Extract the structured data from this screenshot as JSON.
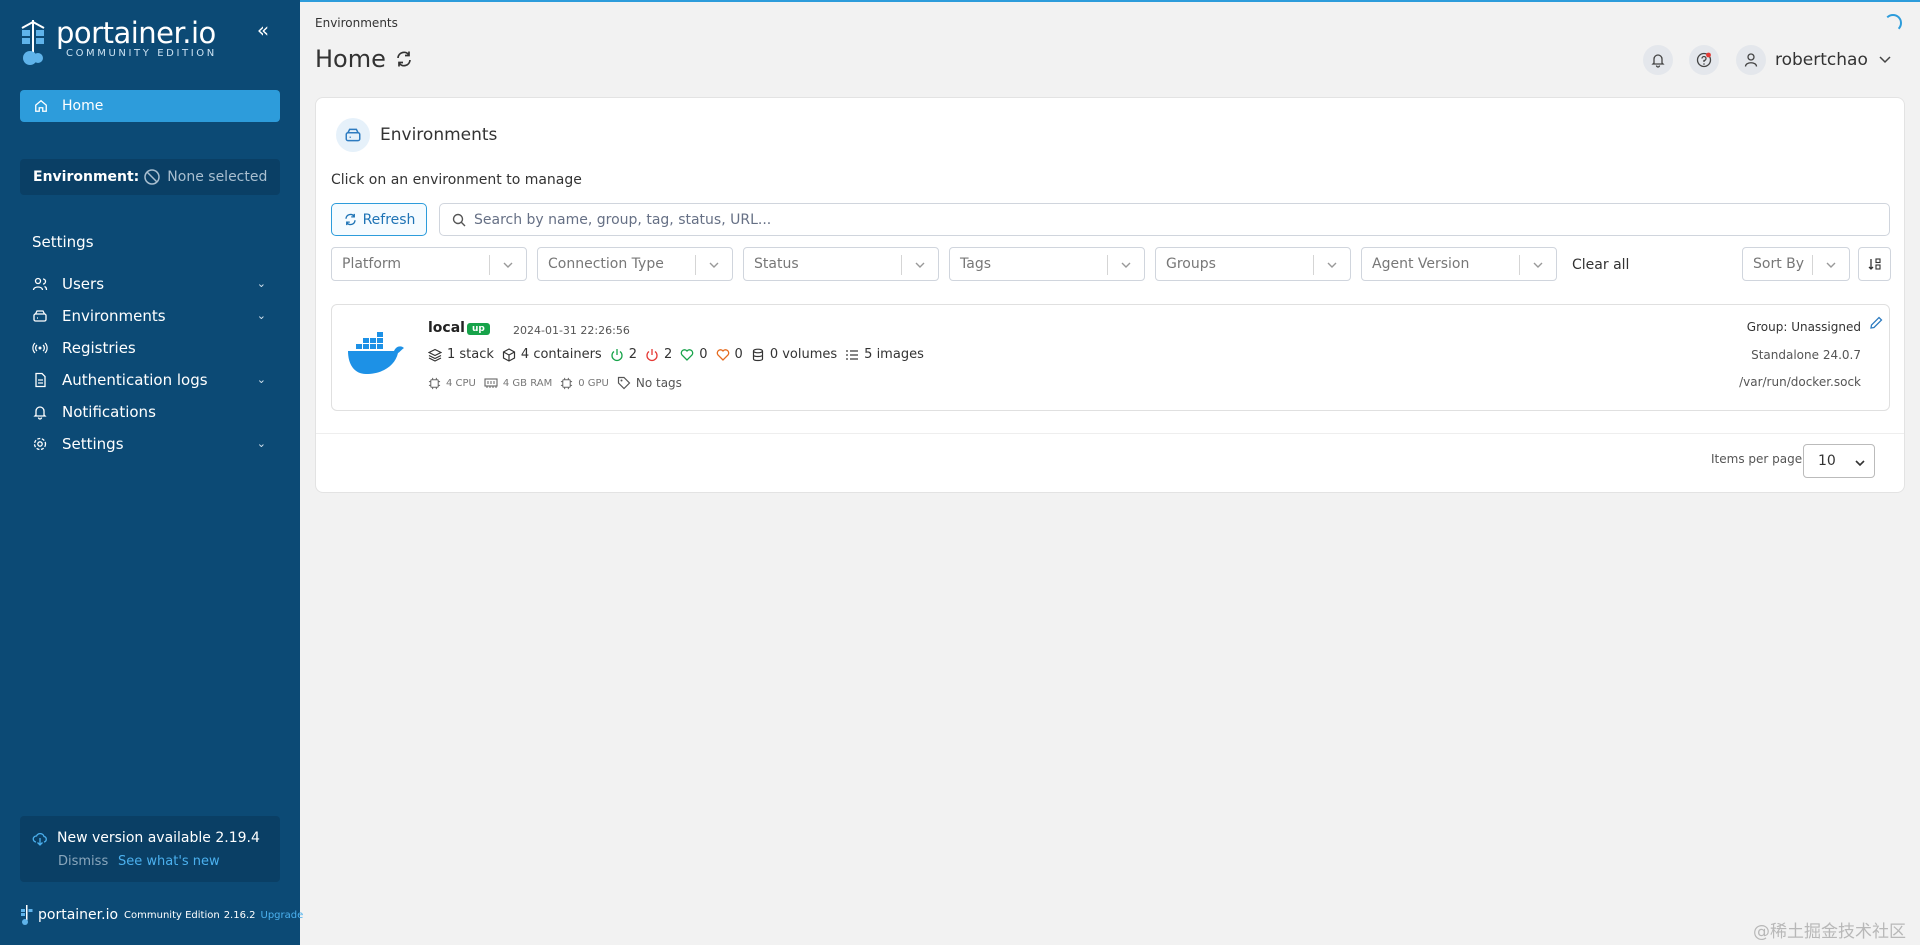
{
  "sidebar": {
    "logo_name": "portainer.io",
    "logo_sub": "COMMUNITY EDITION",
    "home_label": "Home",
    "env_label": "Environment:",
    "env_value": "None selected",
    "settings_heading": "Settings",
    "items": [
      {
        "label": "Users",
        "icon": "users-icon",
        "expandable": true
      },
      {
        "label": "Environments",
        "icon": "environments-icon",
        "expandable": true
      },
      {
        "label": "Registries",
        "icon": "registries-icon",
        "expandable": false
      },
      {
        "label": "Authentication logs",
        "icon": "auth-logs-icon",
        "expandable": true
      },
      {
        "label": "Notifications",
        "icon": "bell-icon",
        "expandable": false
      },
      {
        "label": "Settings",
        "icon": "gear-icon",
        "expandable": true
      }
    ],
    "update": {
      "title": "New version available 2.19.4",
      "dismiss": "Dismiss",
      "link": "See what's new"
    },
    "footer": {
      "name": "portainer.io",
      "edition": "Community Edition",
      "version": "2.16.2",
      "upgrade": "Upgrade"
    }
  },
  "header": {
    "breadcrumb": "Environments",
    "title": "Home",
    "user": "robertchao"
  },
  "panel": {
    "title": "Environments",
    "subtitle": "Click on an environment to manage",
    "refresh_label": "Refresh",
    "search_placeholder": "Search by name, group, tag, status, URL...",
    "filters": [
      "Platform",
      "Connection Type",
      "Status",
      "Tags",
      "Groups",
      "Agent Version"
    ],
    "clear_all": "Clear all",
    "sort_by": "Sort By",
    "environment": {
      "name": "local",
      "status": "up",
      "timestamp": "2024-01-31 22:26:56",
      "stacks": "1 stack",
      "containers": "4 containers",
      "running": "2",
      "stopped": "2",
      "healthy": "0",
      "unhealthy": "0",
      "volumes": "0 volumes",
      "images": "5 images",
      "cpu": "4 CPU",
      "ram": "4 GB RAM",
      "gpu": "0 GPU",
      "tags": "No tags",
      "group": "Group: Unassigned",
      "type": "Standalone 24.0.7",
      "url": "/var/run/docker.sock"
    },
    "items_per_page_label": "Items per page",
    "items_per_page": "10"
  },
  "colors": {
    "sidebar_bg": "#0c4a75",
    "accent": "#2d9cdb",
    "status_up": "#17a34a"
  },
  "watermark": "@稀土掘金技术社区"
}
